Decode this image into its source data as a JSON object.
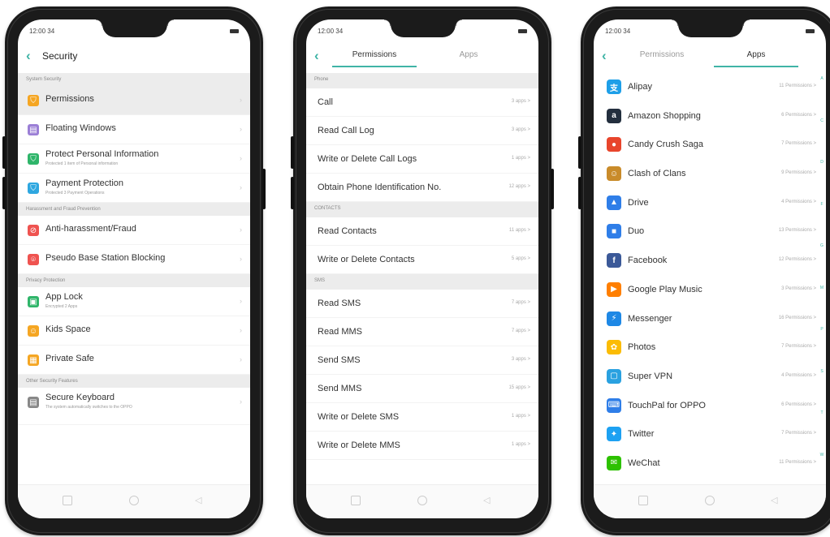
{
  "status": {
    "time": "12:00 34"
  },
  "phone1": {
    "title": "Security",
    "sections": [
      {
        "header": "System Security",
        "items": [
          {
            "label": "Permissions",
            "sub": "",
            "icon": "shield-icon",
            "color": "#f5a623",
            "selected": true
          },
          {
            "label": "Floating Windows",
            "sub": "",
            "icon": "floating-window-icon",
            "color": "#9b7fd6"
          },
          {
            "label": "Protect Personal Information",
            "sub": "Protected 1 item of Personal information",
            "icon": "shield-lock-icon",
            "color": "#2fb56a"
          },
          {
            "label": "Payment Protection",
            "sub": "Protected 3 Payment Operations",
            "icon": "payment-shield-icon",
            "color": "#2ea7e0"
          }
        ]
      },
      {
        "header": "Harassment and Fraud Prevention",
        "items": [
          {
            "label": "Anti-harassment/Fraud",
            "sub": "",
            "icon": "block-icon",
            "color": "#ef5350"
          },
          {
            "label": "Pseudo Base Station Blocking",
            "sub": "",
            "icon": "antenna-icon",
            "color": "#ef5350"
          }
        ]
      },
      {
        "header": "Privacy Protection",
        "items": [
          {
            "label": "App Lock",
            "sub": "Encrypted 2 Apps",
            "icon": "lock-icon",
            "color": "#2fb56a"
          },
          {
            "label": "Kids Space",
            "sub": "",
            "icon": "kid-icon",
            "color": "#f5a623"
          },
          {
            "label": "Private Safe",
            "sub": "",
            "icon": "safe-icon",
            "color": "#f5a623"
          }
        ]
      },
      {
        "header": "Other Security Features",
        "items": [
          {
            "label": "Secure Keyboard",
            "sub": "The system automatically switches to the OPPO",
            "icon": "keyboard-icon",
            "color": "#888888"
          }
        ]
      }
    ]
  },
  "phone2": {
    "tabs": [
      "Permissions",
      "Apps"
    ],
    "active_tab": 0,
    "sections": [
      {
        "header": "Phone",
        "items": [
          {
            "label": "Call",
            "count": "3 apps >"
          },
          {
            "label": "Read Call Log",
            "count": "3 apps >"
          },
          {
            "label": "Write or Delete Call Logs",
            "count": "1 apps >"
          },
          {
            "label": "Obtain Phone Identification No.",
            "count": "12 apps >"
          }
        ]
      },
      {
        "header": "CONTACTS",
        "items": [
          {
            "label": "Read Contacts",
            "count": "11 apps >"
          },
          {
            "label": "Write or Delete Contacts",
            "count": "5 apps >"
          }
        ]
      },
      {
        "header": "SMS",
        "items": [
          {
            "label": "Read SMS",
            "count": "7 apps >"
          },
          {
            "label": "Read MMS",
            "count": "7 apps >"
          },
          {
            "label": "Send SMS",
            "count": "3 apps >"
          },
          {
            "label": "Send MMS",
            "count": "15 apps >"
          },
          {
            "label": "Write or Delete SMS",
            "count": "1 apps >"
          },
          {
            "label": "Write or Delete MMS",
            "count": "1 apps >"
          }
        ]
      }
    ]
  },
  "phone3": {
    "tabs": [
      "Permissions",
      "Apps"
    ],
    "active_tab": 1,
    "apps": [
      {
        "label": "Alipay",
        "count": "11 Permissions >",
        "icon": "alipay-icon",
        "color": "#1e9fe8",
        "glyph": "支"
      },
      {
        "label": "Amazon Shopping",
        "count": "6 Permissions >",
        "icon": "amazon-icon",
        "color": "#232f3e",
        "glyph": "a"
      },
      {
        "label": "Candy Crush Saga",
        "count": "7 Permissions >",
        "icon": "candy-crush-icon",
        "color": "#e8452c",
        "glyph": "●"
      },
      {
        "label": "Clash of Clans",
        "count": "9 Permissions >",
        "icon": "clash-of-clans-icon",
        "color": "#c98b2a",
        "glyph": "☺"
      },
      {
        "label": "Drive",
        "count": "4 Permissions >",
        "icon": "drive-icon",
        "color": "#2f7ee8",
        "glyph": "▲"
      },
      {
        "label": "Duo",
        "count": "13 Permissions >",
        "icon": "duo-icon",
        "color": "#2f7ee8",
        "glyph": "■"
      },
      {
        "label": "Facebook",
        "count": "12 Permissions >",
        "icon": "facebook-icon",
        "color": "#3b5998",
        "glyph": "f"
      },
      {
        "label": "Google Play Music",
        "count": "3 Permissions >",
        "icon": "play-music-icon",
        "color": "#ff7f00",
        "glyph": "▶"
      },
      {
        "label": "Messenger",
        "count": "16 Permissions >",
        "icon": "messenger-icon",
        "color": "#1e88e5",
        "glyph": "⚡"
      },
      {
        "label": "Photos",
        "count": "7 Permissions >",
        "icon": "photos-icon",
        "color": "#fbbc05",
        "glyph": "✿"
      },
      {
        "label": "Super VPN",
        "count": "4 Permissions >",
        "icon": "vpn-icon",
        "color": "#2aa1e0",
        "glyph": "▢"
      },
      {
        "label": "TouchPal for OPPO",
        "count": "6 Permissions >",
        "icon": "touchpal-icon",
        "color": "#2f7ee8",
        "glyph": "⌨"
      },
      {
        "label": "Twitter",
        "count": "7 Permissions >",
        "icon": "twitter-icon",
        "color": "#1da1f2",
        "glyph": "✦"
      },
      {
        "label": "WeChat",
        "count": "11 Permissions >",
        "icon": "wechat-icon",
        "color": "#2dc100",
        "glyph": "✉"
      }
    ],
    "index_letters": [
      "A",
      "C",
      "D",
      "F",
      "G",
      "M",
      "P",
      "S",
      "T",
      "W"
    ]
  }
}
